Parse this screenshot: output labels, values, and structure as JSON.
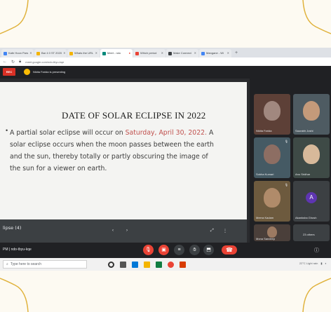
{
  "browser": {
    "tabs": [
      {
        "label": "Kafe Hoon Pars",
        "color": "#4285f4"
      },
      {
        "label": "Bar 4 0 ST 2020",
        "color": "#f4b400"
      },
      {
        "label": "Whats the URL",
        "color": "#f4b400"
      },
      {
        "label": "Meet - ndo",
        "color": "#00897b"
      },
      {
        "label": "Which period",
        "color": "#ea4335"
      },
      {
        "label": "Make Connect",
        "color": "#3c4043"
      },
      {
        "label": "Mangane - Wi",
        "color": "#4285f4"
      }
    ],
    "url": "meet.google.com/ndo-tbyu-kqe"
  },
  "meet": {
    "rec_label": "REC",
    "presenter_text": "Nikita Farida is presenting",
    "meeting_code": "PM | ndo-tbyu-kqe"
  },
  "slide": {
    "title": "DATE OF SOLAR ECLIPSE IN 2022",
    "bullet": "•",
    "line1_pre": "A partial solar eclipse will occur on ",
    "line1_hl": "Saturday, April 30, 2022.",
    "line1_post": " A",
    "line2": "solar eclipse occurs when the moon passes between the earth",
    "line3": "and the sun, thereby totally or partly obscuring the image of",
    "line4": "the sun for a viewer on earth.",
    "caption": "lipse (4)"
  },
  "participants": [
    {
      "name": "Nikita Farida"
    },
    {
      "name": "Saurabh Joshi"
    },
    {
      "name": "Sobha Kumari"
    },
    {
      "name": "Anu Sridhar"
    },
    {
      "name": "Meera Kadam"
    },
    {
      "name": "Akanksha Ghosh",
      "letter": "A"
    },
    {
      "name": "Mona Sandeep"
    },
    {
      "name": "23 others"
    }
  ],
  "taskbar": {
    "search_placeholder": "Type here to search",
    "weather": "22°C Light rain"
  },
  "colors": {
    "accent_red": "#ea4335",
    "slide_highlight": "#c0504d",
    "meet_bg": "#202124"
  }
}
